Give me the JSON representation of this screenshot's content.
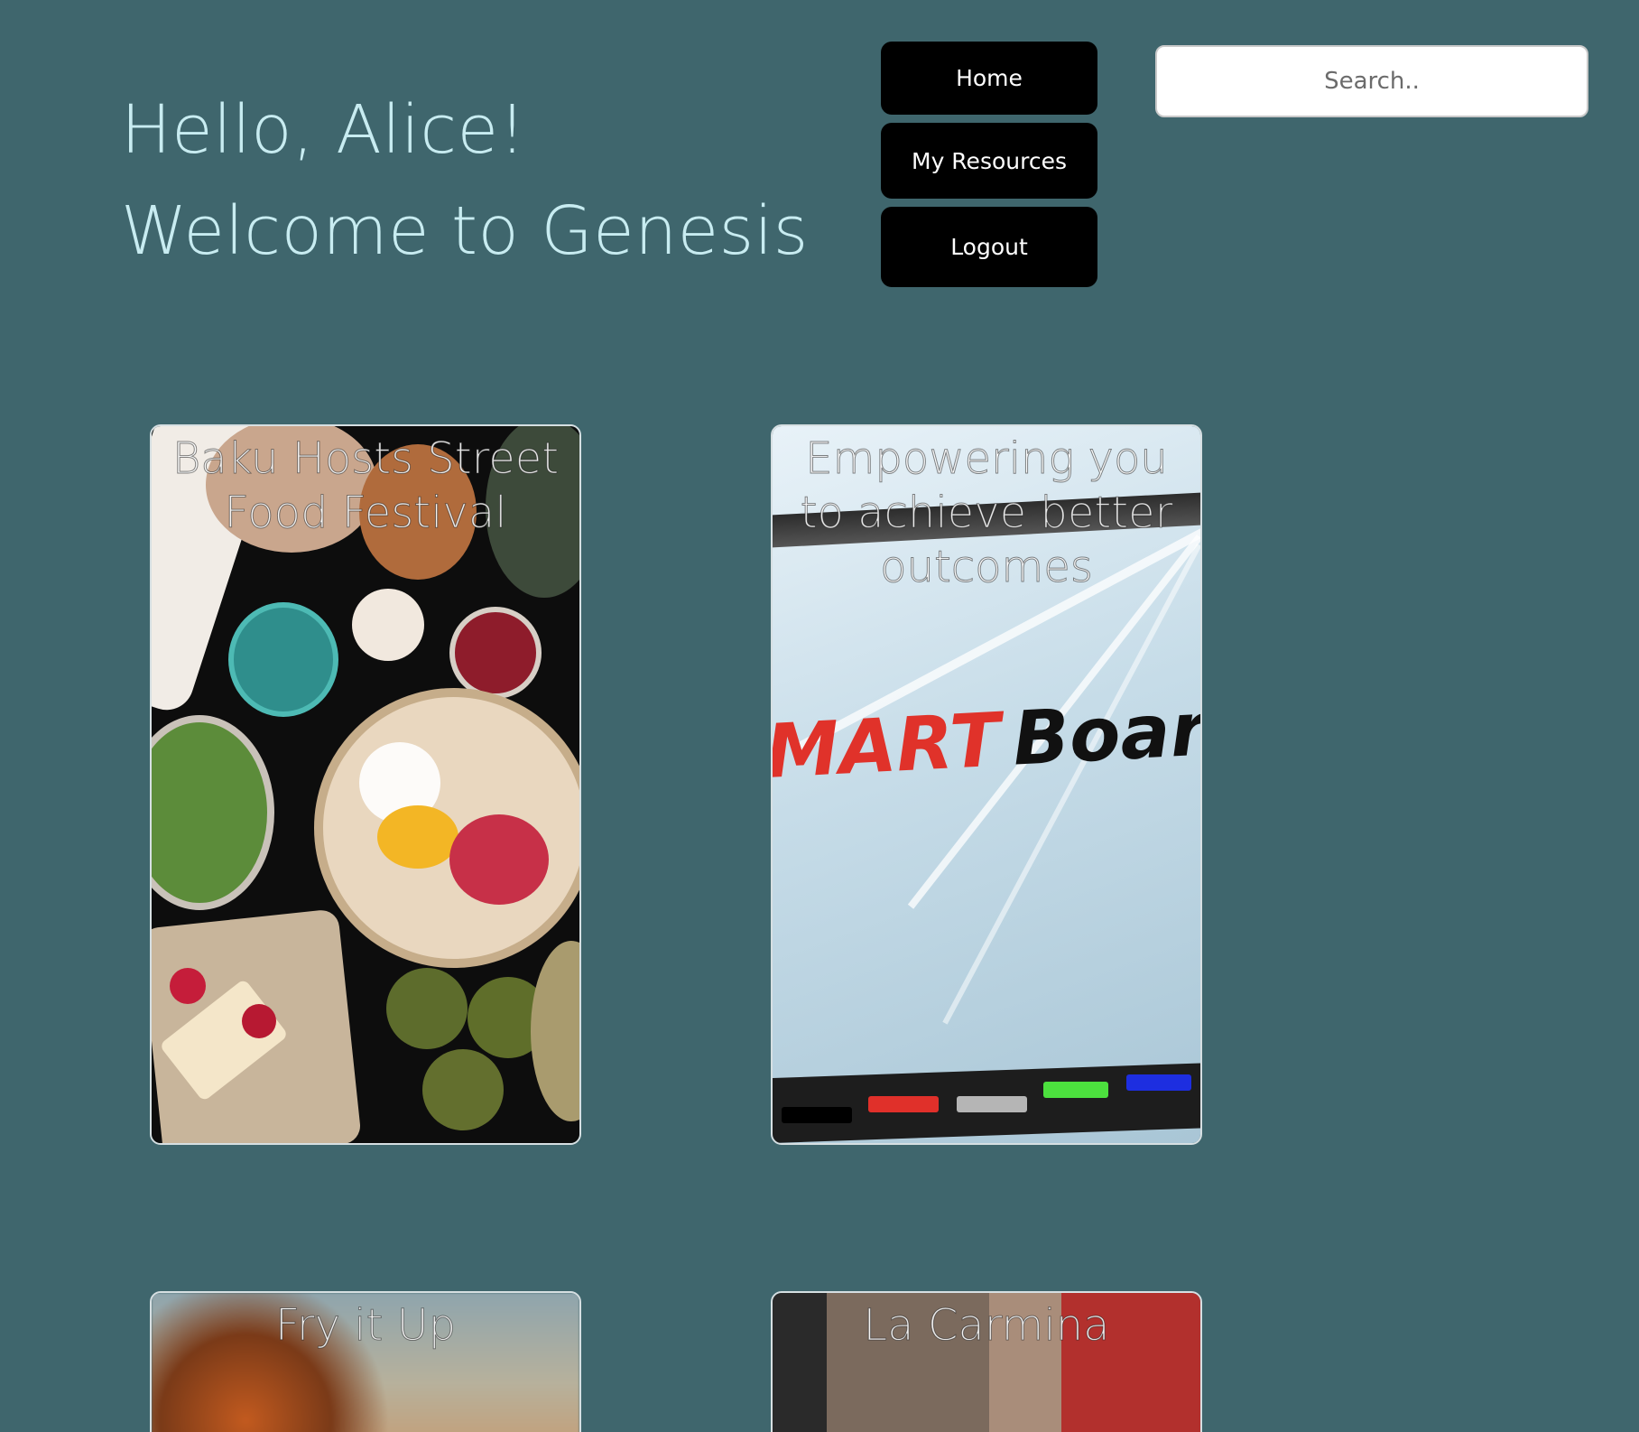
{
  "header": {
    "greeting": "Hello, Alice! Welcome to Genesis"
  },
  "nav": {
    "home_label": "Home",
    "resources_label": "My Resources",
    "logout_label": "Logout"
  },
  "search": {
    "placeholder": "Search.."
  },
  "cards": [
    {
      "title": "Baku Hosts Street Food Festival"
    },
    {
      "title": "Empowering you to achieve better outcomes"
    },
    {
      "title": "Fry it Up"
    },
    {
      "title": "La Carmina"
    }
  ],
  "illustrations": {
    "smartboard_red_text": "MART",
    "smartboard_black_text": "Boarc"
  },
  "colors": {
    "background": "#3f666d",
    "greeting_text": "#c8ecf1",
    "nav_button": "#000000",
    "nav_text": "#ffffff"
  }
}
